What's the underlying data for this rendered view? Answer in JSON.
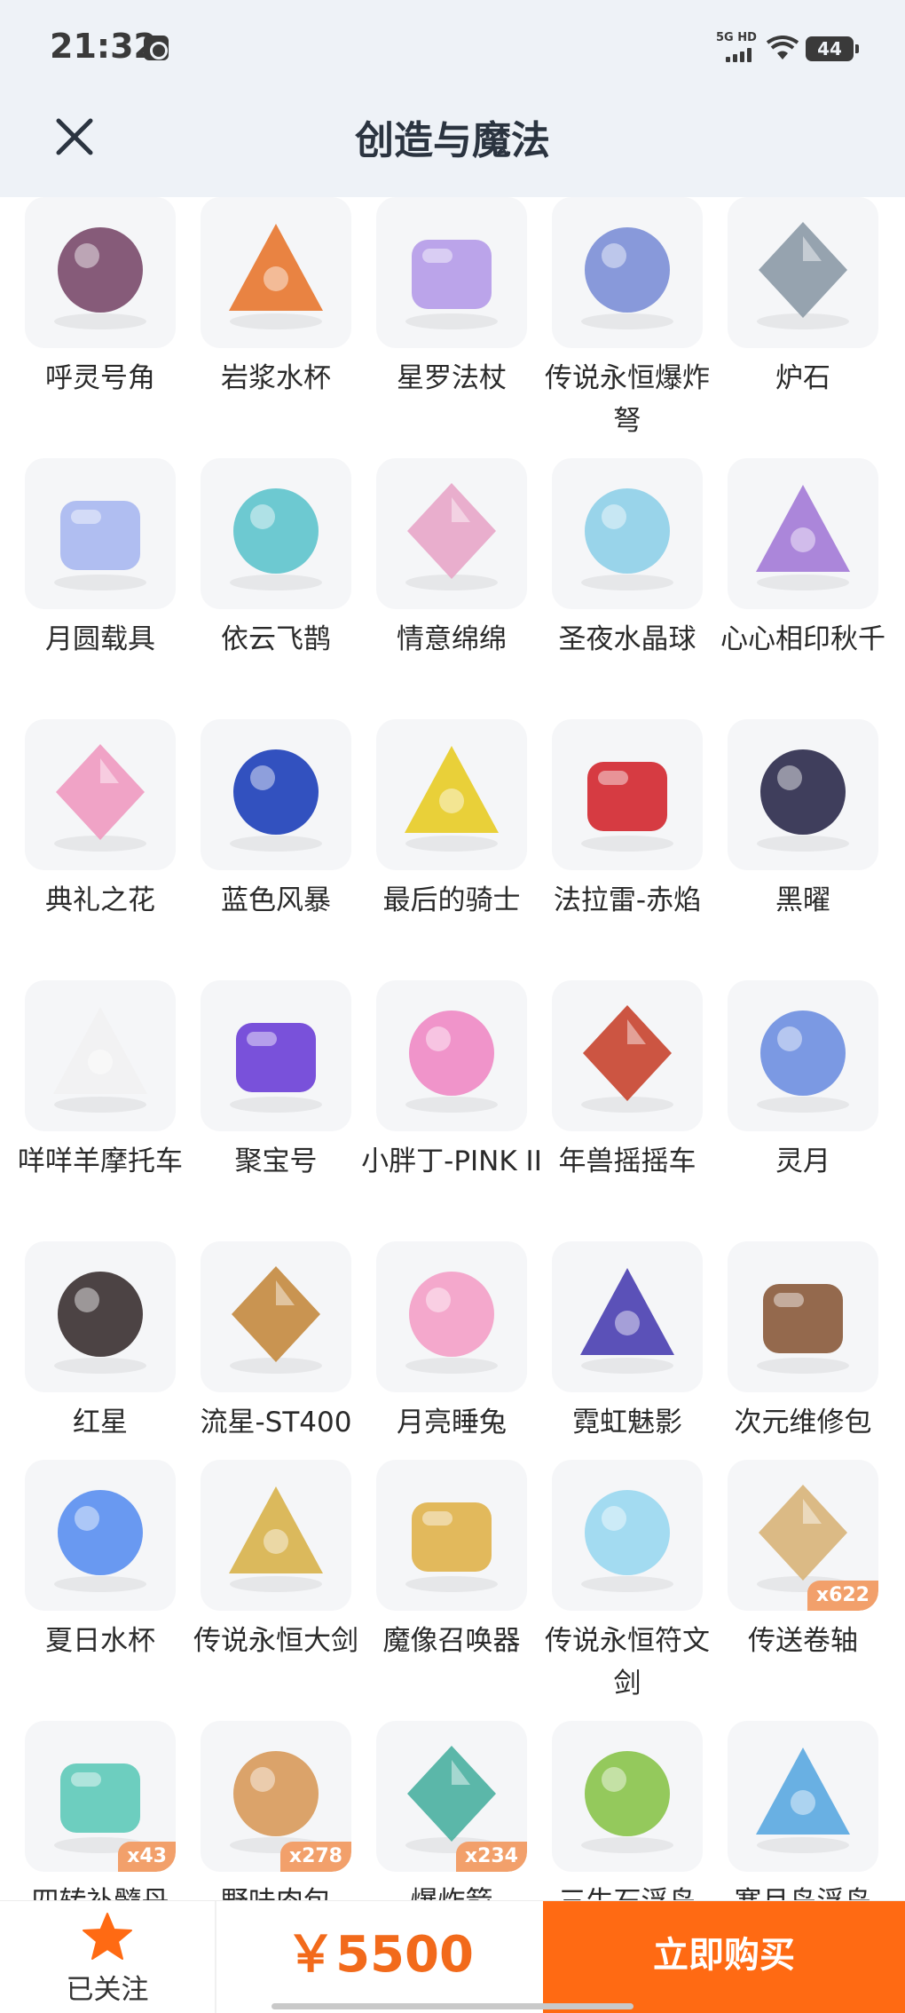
{
  "status_bar": {
    "time": "21:32",
    "network": "5G HD",
    "battery": "44"
  },
  "header": {
    "title": "创造与魔法"
  },
  "items": [
    {
      "name": "呼灵号角",
      "icon": "horn-icon",
      "color": "#7a4a6a"
    },
    {
      "name": "岩浆水杯",
      "icon": "lava-cup-icon",
      "color": "#e8772e"
    },
    {
      "name": "星罗法杖",
      "icon": "star-staff-icon",
      "color": "#b59be8"
    },
    {
      "name": "传说永恒爆炸弩",
      "icon": "crossbow-icon",
      "color": "#7c8fd6"
    },
    {
      "name": "炉石",
      "icon": "hearthstone-icon",
      "color": "#8c9aa6"
    },
    {
      "name": "月圆载具",
      "icon": "moon-cloud-vehicle-icon",
      "color": "#a9b8f0"
    },
    {
      "name": "依云飞鹊",
      "icon": "drone-icon",
      "color": "#5ec4cc"
    },
    {
      "name": "情意绵绵",
      "icon": "love-swing-icon",
      "color": "#e8a6c8"
    },
    {
      "name": "圣夜水晶球",
      "icon": "crystal-ball-icon",
      "color": "#8fd0e8"
    },
    {
      "name": "心心相印秋千",
      "icon": "heart-swing-icon",
      "color": "#a37ad6"
    },
    {
      "name": "典礼之花",
      "icon": "carriage-icon",
      "color": "#f09ac0"
    },
    {
      "name": "蓝色风暴",
      "icon": "blue-race-car-icon",
      "color": "#1d3fb8"
    },
    {
      "name": "最后的骑士",
      "icon": "yellow-car-icon",
      "color": "#e8cc24"
    },
    {
      "name": "法拉雷-赤焰",
      "icon": "red-car-icon",
      "color": "#d3272e"
    },
    {
      "name": "黑曜",
      "icon": "dark-car-icon",
      "color": "#2b2a4a"
    },
    {
      "name": "咩咩羊摩托车",
      "icon": "sheep-scooter-icon",
      "color": "#f2f2f2"
    },
    {
      "name": "聚宝号",
      "icon": "purple-vehicle-icon",
      "color": "#6b3fd6"
    },
    {
      "name": "小胖丁-PINK II",
      "icon": "pink-beetle-icon",
      "color": "#f08ac4"
    },
    {
      "name": "年兽摇摇车",
      "icon": "nian-beast-car-icon",
      "color": "#c8442e"
    },
    {
      "name": "灵月",
      "icon": "crescent-moon-icon",
      "color": "#6e8fe0"
    },
    {
      "name": "红星",
      "icon": "motorcycle-icon",
      "color": "#3a3030"
    },
    {
      "name": "流星-ST400",
      "icon": "meteor-glider-icon",
      "color": "#c48a3e"
    },
    {
      "name": "月亮睡兔",
      "icon": "sleeping-bunny-icon",
      "color": "#f4a0c6"
    },
    {
      "name": "霓虹魅影",
      "icon": "neon-car-icon",
      "color": "#4a3fb0"
    },
    {
      "name": "次元维修包",
      "icon": "repair-bag-icon",
      "color": "#8a5a3a"
    },
    {
      "name": "夏日水杯",
      "icon": "summer-cup-icon",
      "color": "#5a8ff0"
    },
    {
      "name": "传说永恒大剑",
      "icon": "great-sword-icon",
      "color": "#d8b24a"
    },
    {
      "name": "魔像召唤器",
      "icon": "golem-summoner-icon",
      "color": "#e0b24a"
    },
    {
      "name": "传说永恒符文剑",
      "icon": "rune-sword-icon",
      "color": "#9ad8f0"
    },
    {
      "name": "传送卷轴",
      "icon": "teleport-scroll-icon",
      "color": "#d8b478",
      "count": "x622"
    },
    {
      "name": "四转补髓丹",
      "icon": "potion-flask-icon",
      "color": "#5ecab8",
      "count": "x43"
    },
    {
      "name": "野味肉包",
      "icon": "steamed-bun-icon",
      "color": "#d89a5a",
      "count": "x278"
    },
    {
      "name": "爆炸箭",
      "icon": "explosive-arrow-icon",
      "color": "#4ab0a0",
      "count": "x234"
    },
    {
      "name": "三生石浮岛",
      "icon": "floating-island-icon",
      "color": "#8ac44a"
    },
    {
      "name": "寒月岛浮岛",
      "icon": "ice-island-icon",
      "color": "#5aa8e0"
    }
  ],
  "bottom_bar": {
    "follow_label": "已关注",
    "price": "￥5500",
    "buy_label": "立即购买"
  }
}
